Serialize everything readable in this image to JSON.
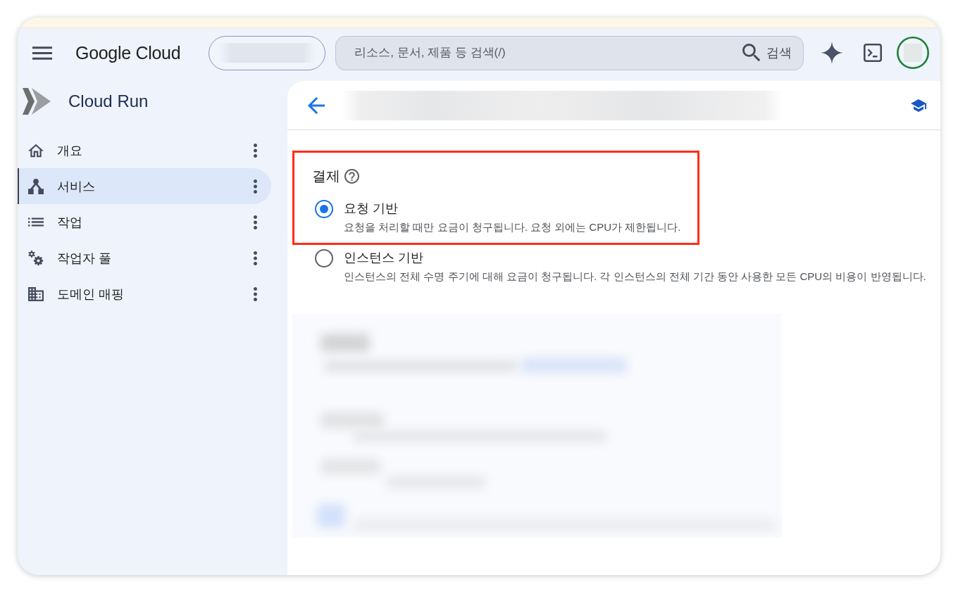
{
  "header": {
    "product_name": "Google Cloud",
    "search": {
      "placeholder": "리소스, 문서, 제품 등 검색(/)",
      "button_label": "검색"
    }
  },
  "sidebar": {
    "title": "Cloud Run",
    "items": [
      {
        "kind": "home",
        "label": "개요",
        "selected": false
      },
      {
        "kind": "service",
        "label": "서비스",
        "selected": true
      },
      {
        "kind": "list",
        "label": "작업",
        "selected": false
      },
      {
        "kind": "gears",
        "label": "작업자 풀",
        "selected": false
      },
      {
        "kind": "building",
        "label": "도메인 매핑",
        "selected": false
      }
    ]
  },
  "billing": {
    "title": "결제",
    "title_highlighted": true,
    "options": [
      {
        "label": "요청 기반",
        "description": "요청을 처리할 때만 요금이 청구됩니다. 요청 외에는 CPU가 제한됩니다.",
        "selected": true,
        "highlighted": true
      },
      {
        "label": "인스턴스 기반",
        "description": "인스턴스의 전체 수명 주기에 대해 요금이 청구됩니다. 각 인스턴스의 전체 기간 동안 사용한 모든 CPU의 비용이 반영됩니다.",
        "selected": false,
        "highlighted": false
      }
    ]
  }
}
